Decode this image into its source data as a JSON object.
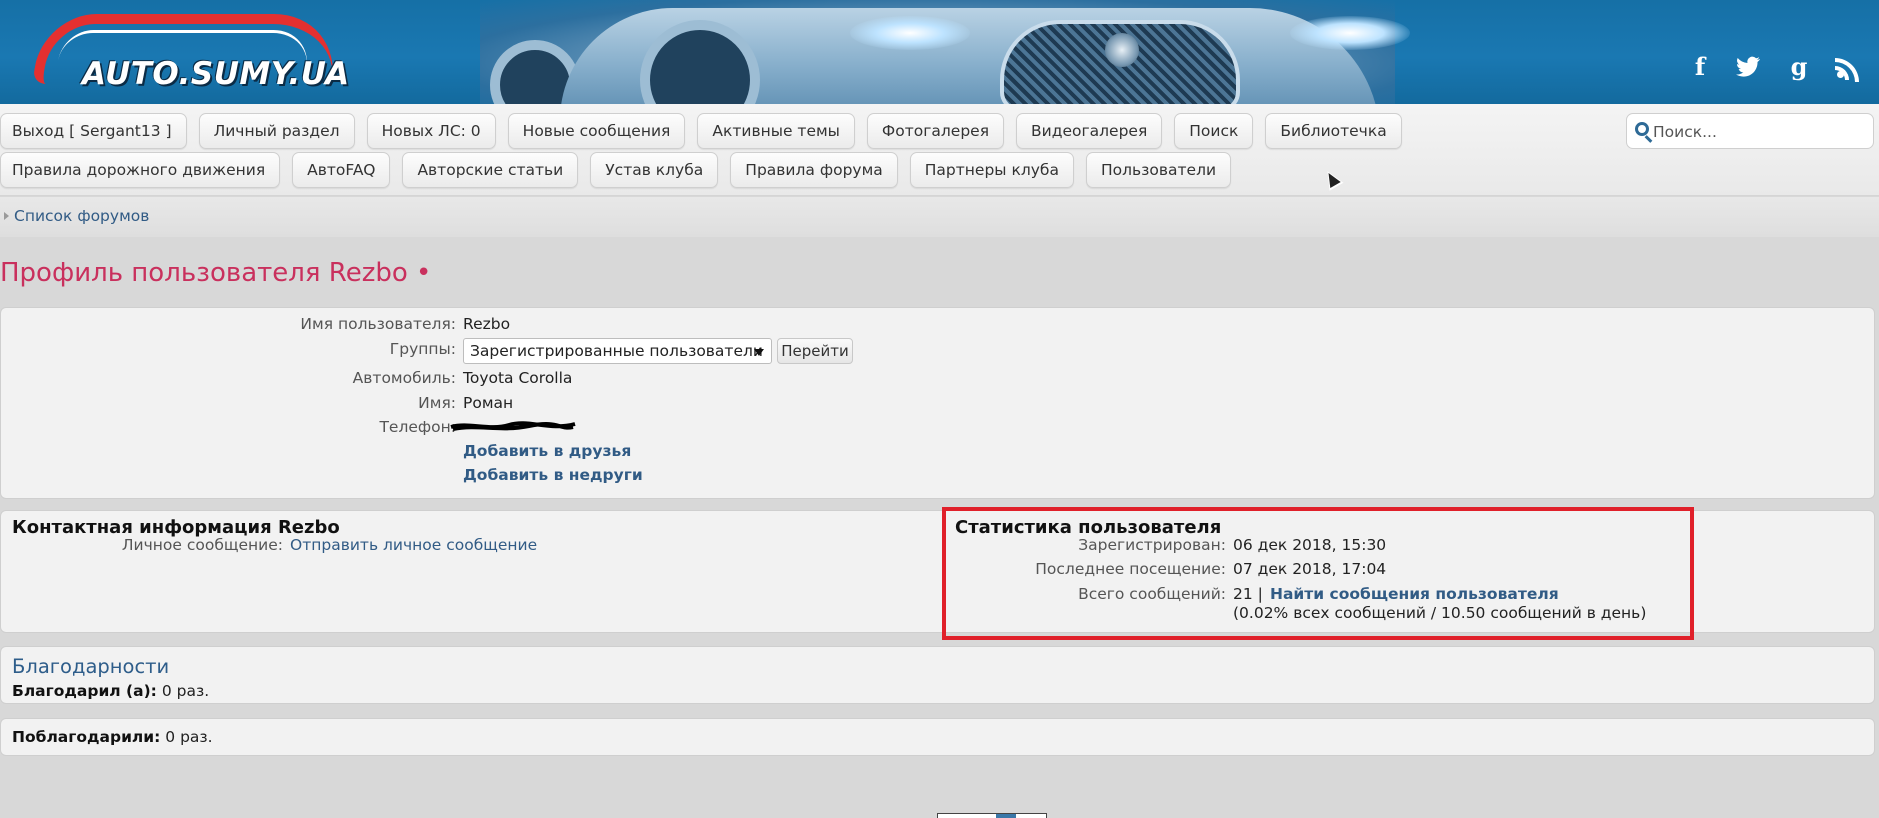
{
  "header": {
    "logo_text": "AUTO.SUMY.UA",
    "social": [
      "facebook-icon",
      "twitter-icon",
      "google-plus-icon",
      "rss-icon"
    ],
    "colors": {
      "header_bg": "#1a78b2",
      "logo_red": "#e43030",
      "title_pink": "#c9305d",
      "link_blue": "#315b85",
      "highlight_red": "#e0202a"
    }
  },
  "nav": {
    "row1": [
      "Выход [ Sergant13 ]",
      "Личный раздел",
      "Новых ЛС: 0",
      "Новые сообщения",
      "Активные темы",
      "Фотогалерея",
      "Видеогалерея",
      "Поиск",
      "Библиотечка"
    ],
    "row2": [
      "Правила дорожного движения",
      "АвтоFAQ",
      "Авторские статьи",
      "Устав клуба",
      "Правила форума",
      "Партнеры клуба",
      "Пользователи"
    ],
    "search_placeholder": "Поиск..."
  },
  "breadcrumb": "Список форумов",
  "page_title": "Профиль пользователя Rezbo •",
  "profile": {
    "username_label": "Имя пользователя:",
    "username": "Rezbo",
    "groups_label": "Группы:",
    "groups_selected": "Зарегистрированные пользователи",
    "go_button": "Перейти",
    "car_label": "Автомобиль:",
    "car": "Toyota Corolla",
    "name_label": "Имя:",
    "name": "Роман",
    "phone_label": "Телефон:",
    "add_friend": "Добавить в друзья",
    "add_foe": "Добавить в недруги"
  },
  "contact": {
    "title": "Контактная информация Rezbo",
    "pm_label": "Личное сообщение:",
    "pm_link": "Отправить личное сообщение"
  },
  "stats": {
    "title": "Статистика пользователя",
    "registered_label": "Зарегистрирован:",
    "registered": "06 дек 2018, 15:30",
    "last_visit_label": "Последнее посещение:",
    "last_visit": "07 дек 2018, 17:04",
    "posts_label": "Всего сообщений:",
    "posts_count": "21 |",
    "find_posts": "Найти сообщения пользователя",
    "posts_detail": "(0.02% всех сообщений / 10.50 сообщений в день)"
  },
  "thanks": {
    "title": "Благодарности",
    "gave_label": "Благодарил (а):",
    "gave_value": "0 раз.",
    "received_label": "Поблагодарили:",
    "received_value": "0 раз."
  }
}
